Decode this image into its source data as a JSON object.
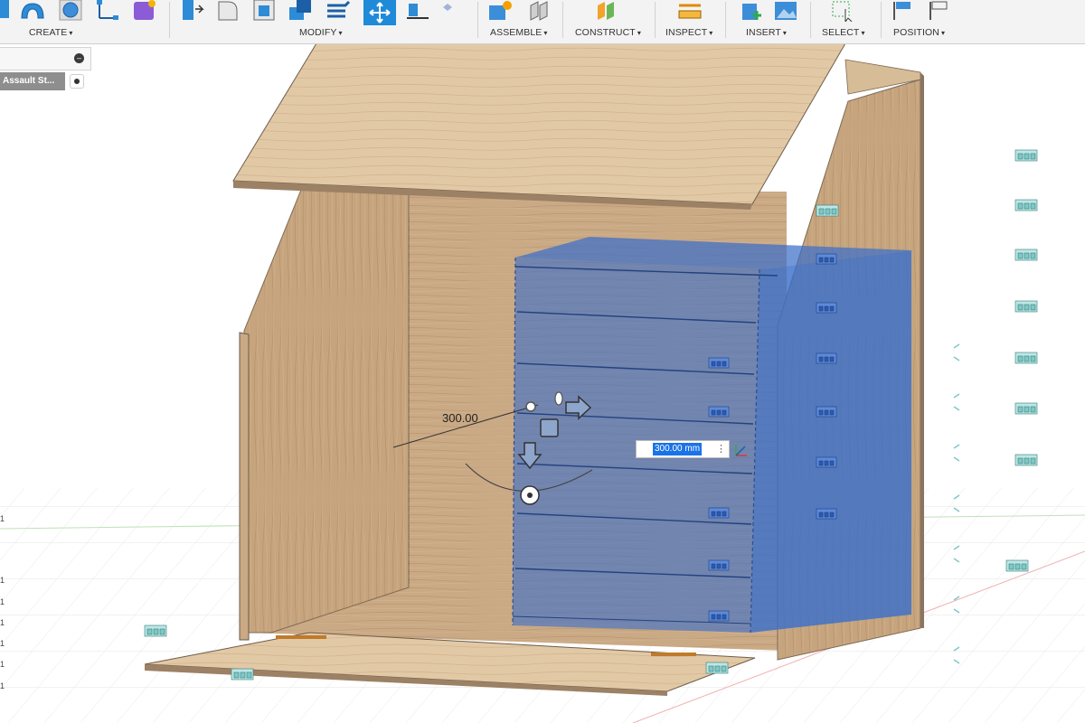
{
  "toolbar": {
    "create_label": "CREATE",
    "modify_label": "MODIFY",
    "assemble_label": "ASSEMBLE",
    "construct_label": "CONSTRUCT",
    "inspect_label": "INSPECT",
    "insert_label": "INSERT",
    "select_label": "SELECT",
    "position_label": "POSITION",
    "dropdown_glyph": "▾"
  },
  "browser": {
    "component_label": "Assault St..."
  },
  "viewport": {
    "dimension_label": "300.00",
    "dimension_input_value": "300.00 mm",
    "more_glyph": "⋮"
  },
  "grid_ticks": [
    "1",
    "1",
    "1",
    "1",
    "1",
    "1",
    "1"
  ],
  "colors": {
    "accent_blue": "#1e6fd8",
    "selection_blue": "#3b6fc9",
    "wood": "#c9ab88",
    "toolbar_bg": "#f3f3f3"
  }
}
